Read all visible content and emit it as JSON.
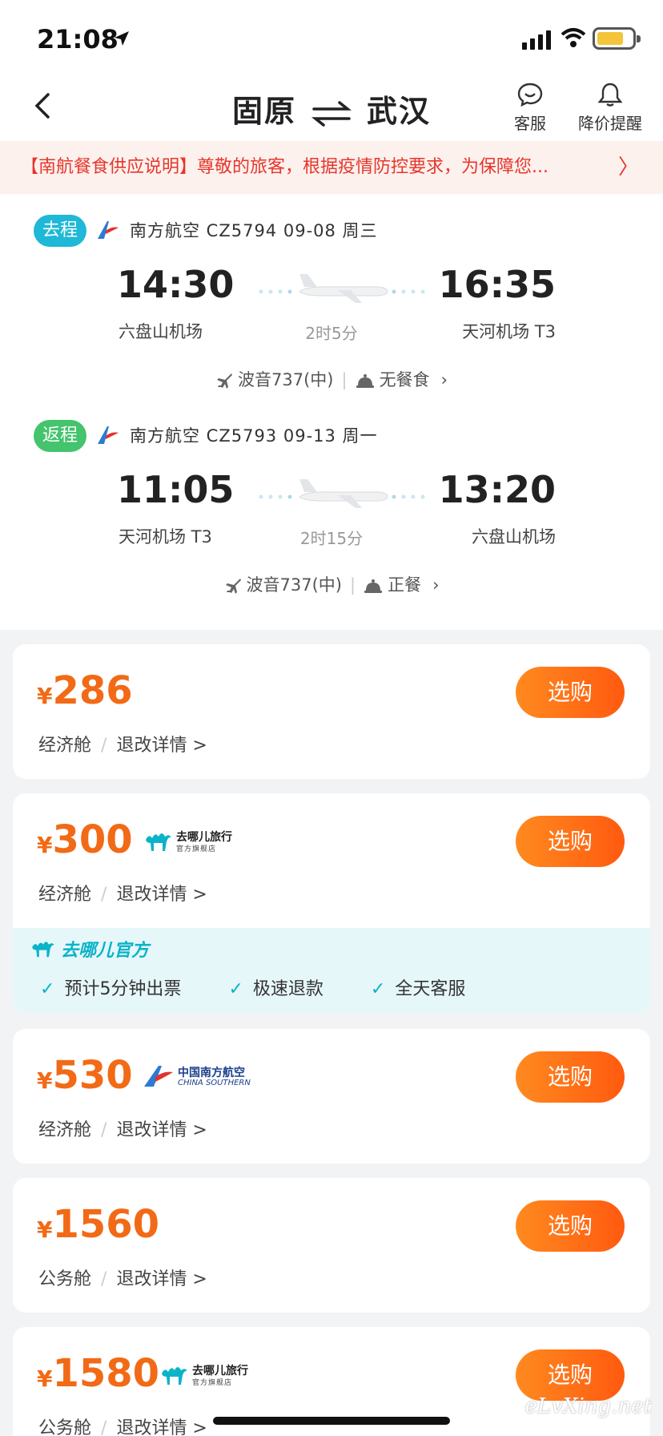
{
  "status_bar": {
    "time": "21:08"
  },
  "nav": {
    "origin": "固原",
    "destination": "武汉",
    "service_label": "客服",
    "alert_label": "降价提醒"
  },
  "notice": {
    "text": "【南航餐食供应说明】尊敬的旅客，根据疫情防控要求，为保障您..."
  },
  "legs": [
    {
      "tag": "去程",
      "tag_color": "#1fb8d6",
      "airline_info": "南方航空 CZ5794  09-08 周三",
      "dep_time": "14:30",
      "dep_airport": "六盘山机场",
      "arr_time": "16:35",
      "arr_airport": "天河机场 T3",
      "duration": "2时5分",
      "aircraft": "波音737(中)",
      "meal": "无餐食"
    },
    {
      "tag": "返程",
      "tag_color": "#43c46d",
      "airline_info": "南方航空 CZ5793  09-13 周一",
      "dep_time": "11:05",
      "dep_airport": "天河机场 T3",
      "arr_time": "13:20",
      "arr_airport": "六盘山机场",
      "duration": "2时15分",
      "aircraft": "波音737(中)",
      "meal": "正餐"
    }
  ],
  "offers": [
    {
      "currency": "¥",
      "price": "286",
      "cabin": "经济舱",
      "detail": "退改详情 >",
      "buy": "选购",
      "badge": ""
    },
    {
      "currency": "¥",
      "price": "300",
      "cabin": "经济舱",
      "detail": "退改详情 >",
      "buy": "选购",
      "badge": "qunar",
      "badge_text": "去哪儿旅行",
      "badge_sub": "官方旗舰店",
      "official_title": "去哪儿官方",
      "features": [
        "预计5分钟出票",
        "极速退款",
        "全天客服"
      ]
    },
    {
      "currency": "¥",
      "price": "530",
      "cabin": "经济舱",
      "detail": "退改详情 >",
      "buy": "选购",
      "badge": "china-southern",
      "badge_text": "中国南方航空",
      "badge_sub": "CHINA SOUTHERN"
    },
    {
      "currency": "¥",
      "price": "1560",
      "cabin": "公务舱",
      "detail": "退改详情 >",
      "buy": "选购",
      "badge": ""
    },
    {
      "currency": "¥",
      "price": "1580",
      "cabin": "公务舱",
      "detail": "退改详情 >",
      "buy": "选购",
      "badge": "qunar",
      "badge_text": "去哪儿旅行",
      "badge_sub": "官方旗舰店"
    }
  ],
  "watermark": "eLvXing.net",
  "colors": {
    "accent": "#ff6a13",
    "notice_red": "#e6362b",
    "qunar_teal": "#0bb3c9",
    "cs_blue": "#1b3f8c"
  },
  "icons": [
    "location-arrow-icon",
    "signal-icon",
    "wifi-icon",
    "battery-icon",
    "back-icon",
    "swap-icon",
    "chat-icon",
    "bell-icon",
    "chevron-right-icon",
    "airline-logo-icon",
    "airplane-icon",
    "meal-icon",
    "camel-icon",
    "checkmark-icon"
  ]
}
